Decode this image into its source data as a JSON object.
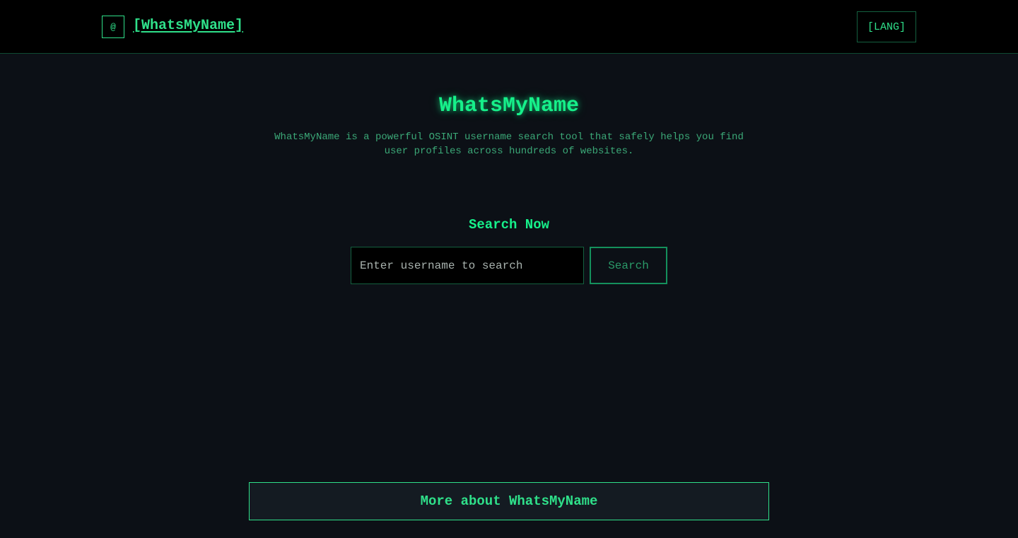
{
  "header": {
    "logo_icon": "@",
    "logo_icon_name": "at-sign-icon",
    "title": "[WhatsMyName]",
    "lang_label": "[LANG]"
  },
  "hero": {
    "title": "WhatsMyName",
    "description": "WhatsMyName is a powerful OSINT username search tool that safely helps you find user profiles across hundreds of websites."
  },
  "search": {
    "heading": "Search Now",
    "input_value": "",
    "placeholder": "Enter username to search",
    "button_label": "Search"
  },
  "footer": {
    "more_label": "More about WhatsMyName"
  },
  "colors": {
    "background": "#0c1016",
    "header_background": "#000000",
    "accent": "#16f08a",
    "muted_accent": "#3ba877",
    "border": "#14603f"
  }
}
